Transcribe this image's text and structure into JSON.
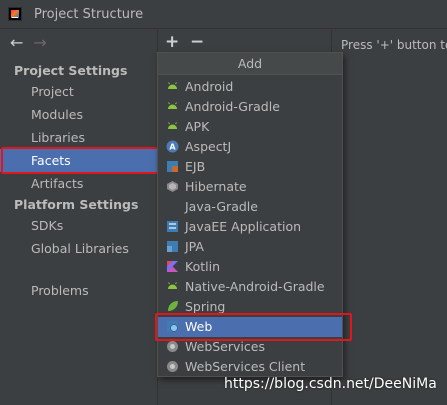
{
  "window": {
    "title": "Project Structure"
  },
  "toolbar": {
    "back_icon": "back-arrow",
    "forward_icon": "forward-arrow",
    "add_label": "+",
    "remove_label": "−"
  },
  "sidebar": {
    "project_settings_heading": "Project Settings",
    "project_items": [
      "Project",
      "Modules",
      "Libraries",
      "Facets",
      "Artifacts"
    ],
    "platform_settings_heading": "Platform Settings",
    "platform_items": [
      "SDKs",
      "Global Libraries"
    ],
    "problems_label": "Problems",
    "selected": "Facets"
  },
  "content": {
    "hint": "Press '+' button to"
  },
  "add_menu": {
    "title": "Add",
    "items": [
      {
        "label": "Android",
        "icon": "android-icon"
      },
      {
        "label": "Android-Gradle",
        "icon": "android-icon"
      },
      {
        "label": "APK",
        "icon": "android-icon"
      },
      {
        "label": "AspectJ",
        "icon": "aspectj-icon"
      },
      {
        "label": "EJB",
        "icon": "ejb-icon"
      },
      {
        "label": "Hibernate",
        "icon": "hibernate-icon"
      },
      {
        "label": "Java-Gradle",
        "icon": ""
      },
      {
        "label": "JavaEE Application",
        "icon": "javaee-icon"
      },
      {
        "label": "JPA",
        "icon": "jpa-icon"
      },
      {
        "label": "Kotlin",
        "icon": "kotlin-icon"
      },
      {
        "label": "Native-Android-Gradle",
        "icon": "android-icon"
      },
      {
        "label": "Spring",
        "icon": "spring-icon"
      },
      {
        "label": "Web",
        "icon": "web-icon"
      },
      {
        "label": "WebServices",
        "icon": "webservices-icon"
      },
      {
        "label": "WebServices Client",
        "icon": "webservices-icon"
      }
    ],
    "selected": "Web"
  },
  "watermark": "https://blog.csdn.net/DeeNiMa",
  "colors": {
    "selection": "#4b6eaf",
    "highlight_outline": "#e0161a",
    "background": "#3c3f41",
    "android": "#8ac53e"
  }
}
